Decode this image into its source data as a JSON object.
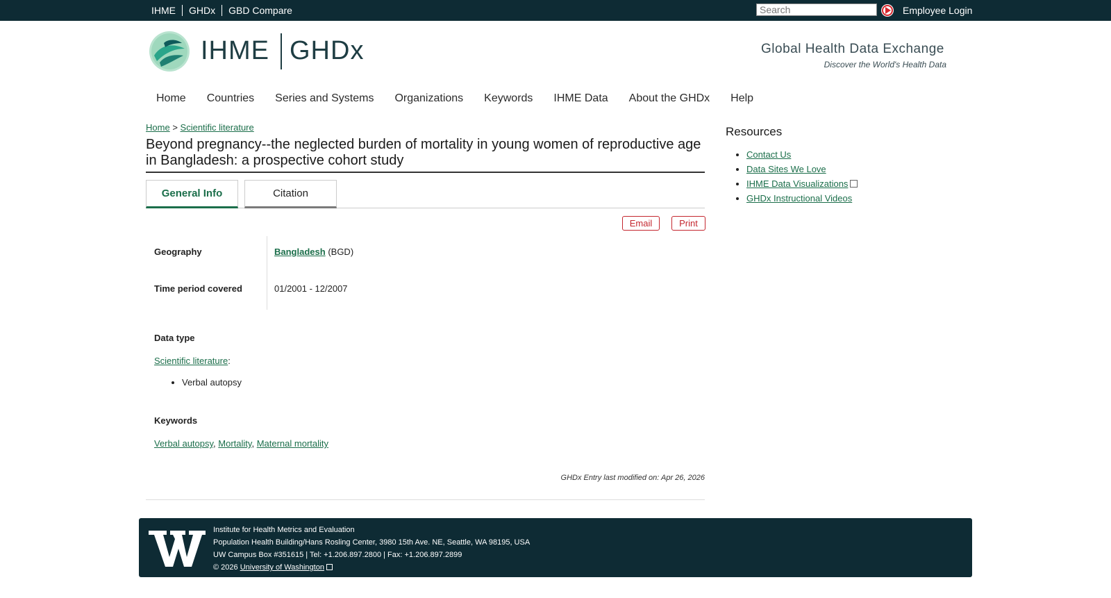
{
  "topbar": {
    "links": [
      "IHME",
      "GHDx",
      "GBD Compare"
    ],
    "search_placeholder": "Search",
    "employee_login": "Employee Login"
  },
  "brand": {
    "ihme": "IHME",
    "ghdx": "GHDx",
    "tagline": "Global Health Data Exchange",
    "subtagline": "Discover the World's Health Data"
  },
  "mainnav": [
    "Home",
    "Countries",
    "Series and Systems",
    "Organizations",
    "Keywords",
    "IHME Data",
    "About the GHDx",
    "Help"
  ],
  "breadcrumb": {
    "home": "Home",
    "separator": ">",
    "current": "Scientific literature"
  },
  "page_title": "Beyond pregnancy--the neglected burden of mortality in young women of reproductive age in Bangladesh: a prospective cohort study",
  "tabs": [
    "General Info",
    "Citation"
  ],
  "actions": {
    "email": "Email",
    "print": "Print"
  },
  "details": {
    "geography_label": "Geography",
    "geography_link": "Bangladesh",
    "geography_code": "(BGD)",
    "time_label": "Time period covered",
    "time_value": "01/2001 - 12/2007",
    "datatype_label": "Data type",
    "datatype_link": "Scientific literature",
    "datatype_colon": ":",
    "datatype_items": [
      "Verbal autopsy"
    ],
    "keywords_label": "Keywords",
    "keywords": [
      "Verbal autopsy",
      "Mortality",
      "Maternal mortality"
    ],
    "keyword_separator": ","
  },
  "modified": "GHDx Entry last modified on: Apr 26, 2026",
  "resources": {
    "title": "Resources",
    "items": [
      "Contact Us",
      "Data Sites We Love",
      "IHME Data Visualizations",
      "GHDx Instructional Videos"
    ]
  },
  "footer": {
    "line1": "Institute for Health Metrics and Evaluation",
    "line2": "Population Health Building/Hans Rosling Center, 3980 15th Ave. NE, Seattle, WA 98195, USA",
    "line3": "UW Campus Box #351615 | Tel: +1.206.897.2800 | Fax: +1.206.897.2899",
    "copyright": "© 2026",
    "uw_link": "University of Washington"
  },
  "colors": {
    "topbar": "#0e2b34",
    "link": "#1b6e4a",
    "action": "#c4262e"
  }
}
